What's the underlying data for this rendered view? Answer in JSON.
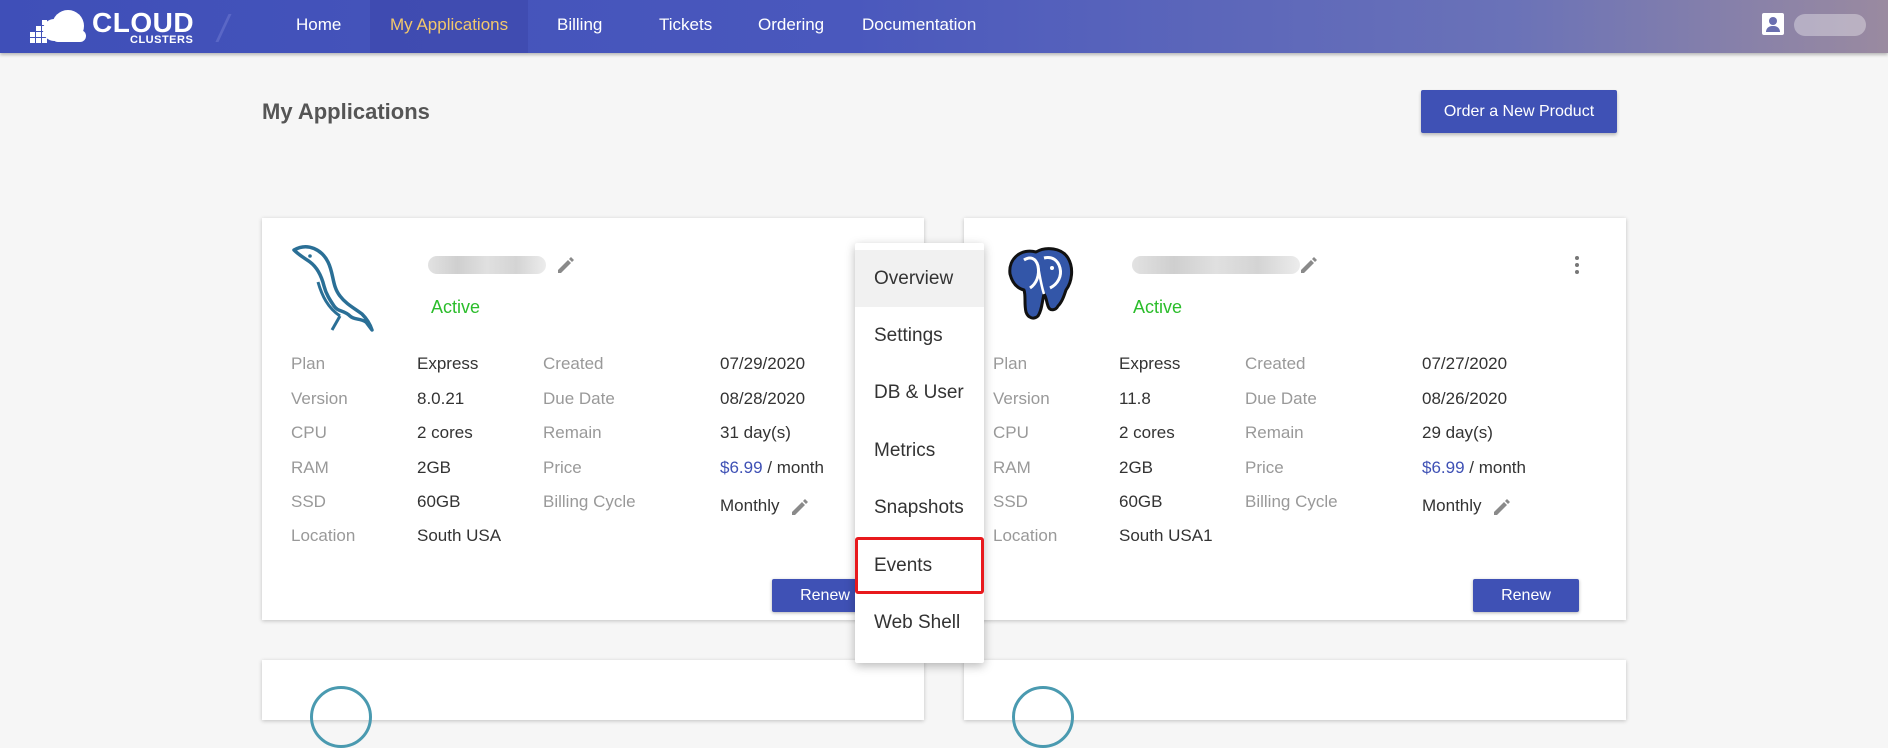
{
  "brand": {
    "line1": "CLOUD",
    "line2": "CLUSTERS"
  },
  "nav": [
    {
      "label": "Home"
    },
    {
      "label": "My Applications"
    },
    {
      "label": "Billing"
    },
    {
      "label": "Tickets"
    },
    {
      "label": "Ordering"
    },
    {
      "label": "Documentation"
    }
  ],
  "nav_active": "My Applications",
  "page": {
    "title": "My Applications",
    "order_button": "Order a New Product"
  },
  "labels": {
    "plan": "Plan",
    "version": "Version",
    "cpu": "CPU",
    "ram": "RAM",
    "ssd": "SSD",
    "location": "Location",
    "created": "Created",
    "due_date": "Due Date",
    "remain": "Remain",
    "price": "Price",
    "billing_cycle": "Billing Cycle",
    "per_month": "/ month",
    "renew": "Renew"
  },
  "cards": [
    {
      "db_icon": "mysql-dolphin-icon",
      "status": "Active",
      "plan": "Express",
      "version": "8.0.21",
      "cpu": "2 cores",
      "ram": "2GB",
      "ssd": "60GB",
      "location": "South USA",
      "created": "07/29/2020",
      "due_date": "08/28/2020",
      "remain": "31 day(s)",
      "price": "$6.99",
      "billing_cycle": "Monthly"
    },
    {
      "db_icon": "postgresql-elephant-icon",
      "status": "Active",
      "plan": "Express",
      "version": "11.8",
      "cpu": "2 cores",
      "ram": "2GB",
      "ssd": "60GB",
      "location": "South USA1",
      "created": "07/27/2020",
      "due_date": "08/26/2020",
      "remain": "29 day(s)",
      "price": "$6.99",
      "billing_cycle": "Monthly"
    }
  ],
  "menu": {
    "items": [
      {
        "label": "Overview"
      },
      {
        "label": "Settings"
      },
      {
        "label": "DB & User"
      },
      {
        "label": "Metrics"
      },
      {
        "label": "Snapshots"
      },
      {
        "label": "Events"
      },
      {
        "label": "Web Shell"
      }
    ],
    "hovered": "Overview",
    "highlighted": "Events"
  },
  "colors": {
    "accent": "#3f51b5",
    "active_status": "#2bbd2b",
    "nav_active_text": "#f3c86b",
    "highlight_box": "#e8191d"
  }
}
